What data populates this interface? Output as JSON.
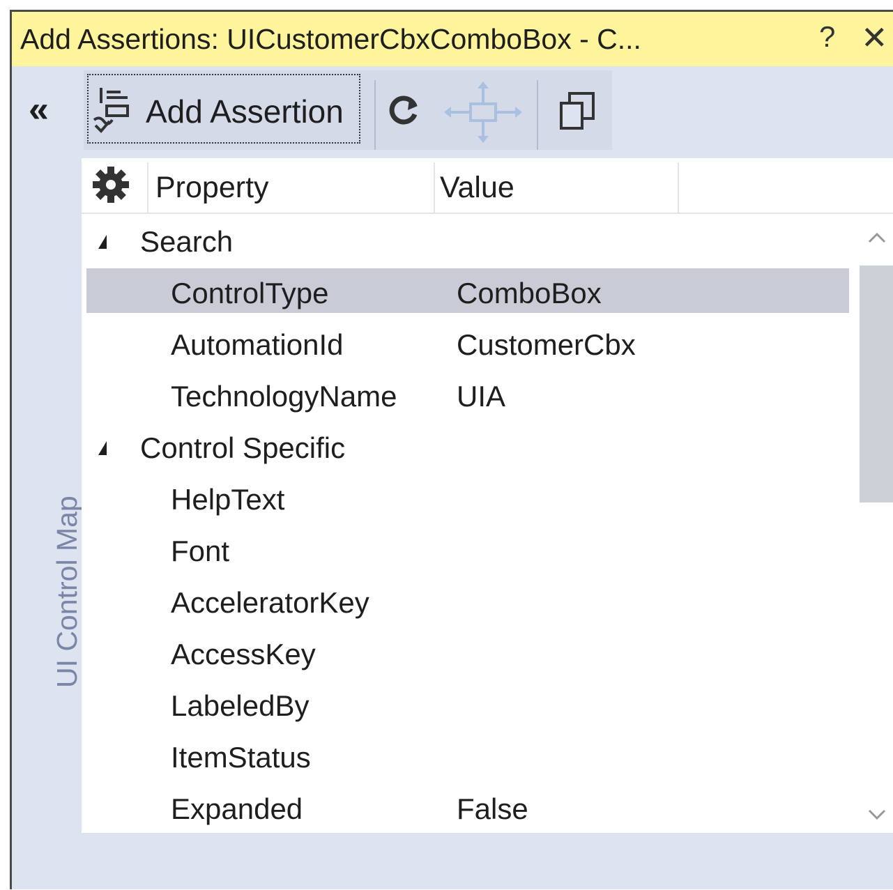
{
  "window": {
    "title": "Add Assertions: UICustomerCbxComboBox - C...",
    "help_label": "?",
    "close_label": "✕"
  },
  "toolbar": {
    "collapse_label": "«",
    "add_assertion_label": "Add Assertion"
  },
  "sidebar": {
    "label": "UI Control Map"
  },
  "grid": {
    "header": {
      "property": "Property",
      "value": "Value"
    },
    "rows": [
      {
        "kind": "category",
        "name": "Search",
        "value": ""
      },
      {
        "kind": "property",
        "name": "ControlType",
        "value": "ComboBox",
        "selected": true
      },
      {
        "kind": "property",
        "name": "AutomationId",
        "value": "CustomerCbx"
      },
      {
        "kind": "property",
        "name": "TechnologyName",
        "value": "UIA"
      },
      {
        "kind": "category",
        "name": "Control Specific",
        "value": ""
      },
      {
        "kind": "property",
        "name": "HelpText",
        "value": ""
      },
      {
        "kind": "property",
        "name": "Font",
        "value": ""
      },
      {
        "kind": "property",
        "name": "AcceleratorKey",
        "value": ""
      },
      {
        "kind": "property",
        "name": "AccessKey",
        "value": ""
      },
      {
        "kind": "property",
        "name": "LabeledBy",
        "value": ""
      },
      {
        "kind": "property",
        "name": "ItemStatus",
        "value": ""
      },
      {
        "kind": "property",
        "name": "Expanded",
        "value": "False"
      }
    ]
  },
  "icons": {
    "assert": "add-assertion-icon",
    "refresh": "refresh-icon",
    "move": "move-icon",
    "copy": "copy-icon",
    "gear": "gear-icon",
    "expander": "expanded-triangle-icon"
  },
  "colors": {
    "titlebar": "#fdf49c",
    "chrome": "#dde3ef",
    "selection": "#c9ccd7"
  }
}
